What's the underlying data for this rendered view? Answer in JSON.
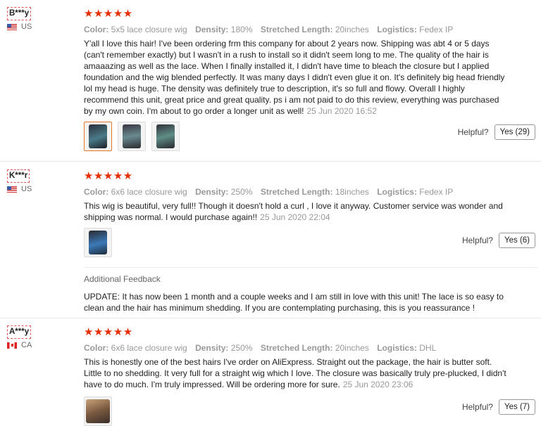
{
  "labels": {
    "color": "Color:",
    "density": "Density:",
    "stretched_length": "Stretched Length:",
    "logistics": "Logistics:",
    "helpful": "Helpful?",
    "stars": "★★★★★",
    "additional_feedback": "Additional Feedback"
  },
  "colors": {
    "star": "#e62e04",
    "active_thumb": "#e07a2a"
  },
  "reviews": [
    {
      "user": "B***y",
      "country": "US",
      "rating": 5,
      "color": "5x5 lace closure wig",
      "density": "180%",
      "stretched_length": "20inches",
      "logistics": "Fedex IP",
      "text": "Y'all I love this hair! I've been ordering frm this company for about 2 years now. Shipping was abt 4 or 5 days (can't remember exactly) but I wasn't in a rush to install so it didn't seem long to me. The quality of the hair is amaaazing as well as the lace. When I finally installed it, I didn't have time to bleach the closure but I applied foundation and the wig blended perfectly. It was many days I didn't even glue it on. It's definitely big head friendly lol my head is huge. The density was definitely true to description, it's so full and flowy. Overall I highly recommend this unit, great price and great quality. ps i am not paid to do this review, everything was purchased by my own coin. I'm about to go order a longer unit as well!",
      "date": "25 Jun 2020 16:52",
      "helpful": "Yes (29)"
    },
    {
      "user": "K***r",
      "country": "US",
      "rating": 5,
      "color": "6x6 lace closure wig",
      "density": "250%",
      "stretched_length": "18inches",
      "logistics": "Fedex IP",
      "text": "This wig is beautiful, very full!! Though it doesn't hold a curl , I love it anyway. Customer service was wonder and shipping was normal. I would purchase again!!",
      "date": "25 Jun 2020 22:04",
      "helpful": "Yes (6)",
      "additional_feedback": "UPDATE: It has now been 1 month and a couple weeks and I am still in love with this unit! The lace is so easy to clean and the hair has minimum shedding. If you are contemplating purchasing, this is you reassurance !"
    },
    {
      "user": "A***y",
      "country": "CA",
      "rating": 5,
      "color": "6x6 lace closure wig",
      "density": "250%",
      "stretched_length": "20inches",
      "logistics": "DHL",
      "text": "This is honestly one of the best hairs I've order on AliExpress. Straight out the package, the hair is butter soft. Little to no shedding. It very full for a straight wig which I love. The closure was basically truly pre-plucked, I didn't have to do much. I'm truly impressed. Will be ordering more for sure.",
      "date": "25 Jun 2020 23:06",
      "helpful": "Yes (7)"
    }
  ]
}
